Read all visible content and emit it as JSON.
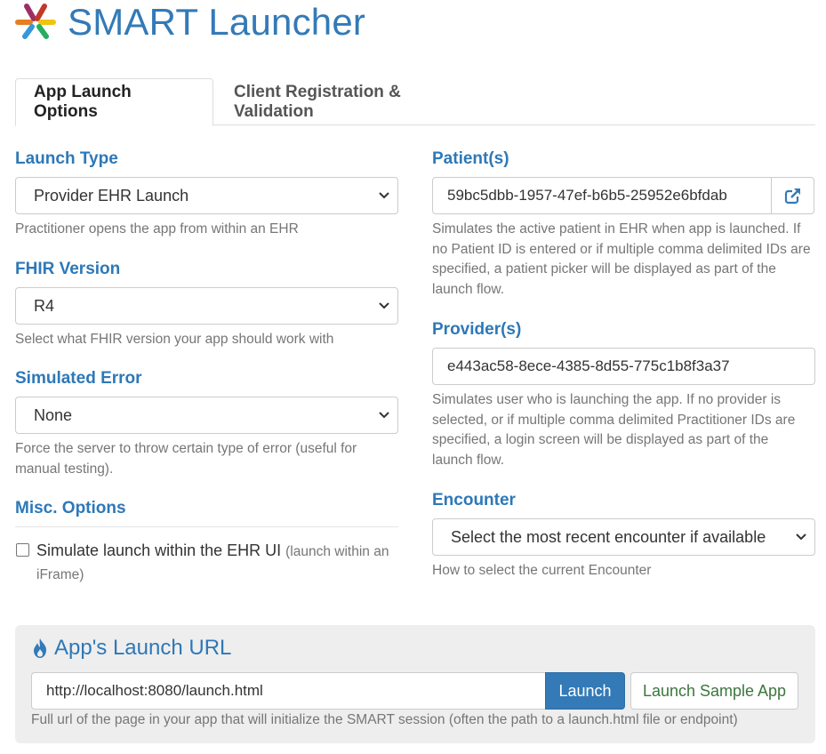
{
  "header": {
    "title": "SMART Launcher",
    "logo_icon": "smart-logo-icon"
  },
  "tabs": [
    {
      "label": "App Launch Options",
      "active": true
    },
    {
      "label": "Client Registration & Validation",
      "active": false
    }
  ],
  "left": {
    "launch_type": {
      "label": "Launch Type",
      "selected": "Provider EHR Launch",
      "help": "Practitioner opens the app from within an EHR"
    },
    "fhir_version": {
      "label": "FHIR Version",
      "selected": "R4",
      "help": "Select what FHIR version your app should work with"
    },
    "simulated_error": {
      "label": "Simulated Error",
      "selected": "None",
      "help": "Force the server to throw certain type of error (useful for manual testing)."
    },
    "misc": {
      "label": "Misc. Options",
      "checkbox_label": "Simulate launch within the EHR UI",
      "checkbox_hint": "(launch within an iFrame)",
      "checked": false
    }
  },
  "right": {
    "patients": {
      "label": "Patient(s)",
      "value": "59bc5dbb-1957-47ef-b6b5-25952e6bfdab",
      "button_icon": "open-external-icon",
      "help": "Simulates the active patient in EHR when app is launched. If no Patient ID is entered or if multiple comma delimited IDs are specified, a patient picker will be displayed as part of the launch flow."
    },
    "providers": {
      "label": "Provider(s)",
      "value": "e443ac58-8ece-4385-8d55-775c1b8f3a37",
      "help": "Simulates user who is launching the app. If no provider is selected, or if multiple comma delimited Practitioner IDs are specified, a login screen will be displayed as part of the launch flow."
    },
    "encounter": {
      "label": "Encounter",
      "selected": "Select the most recent encounter if available",
      "help": "How to select the current Encounter"
    }
  },
  "launch_panel": {
    "title": "App's Launch URL",
    "title_icon": "fire-icon",
    "url": "http://localhost:8080/launch.html",
    "launch_label": "Launch",
    "sample_label": "Launch Sample App",
    "help": "Full url of the page in your app that will initialize the SMART session (often the path to a launch.html file or endpoint)"
  },
  "colors": {
    "accent": "#337ab7",
    "label": "#2e78b7",
    "sample_button_text": "#3c763d"
  }
}
